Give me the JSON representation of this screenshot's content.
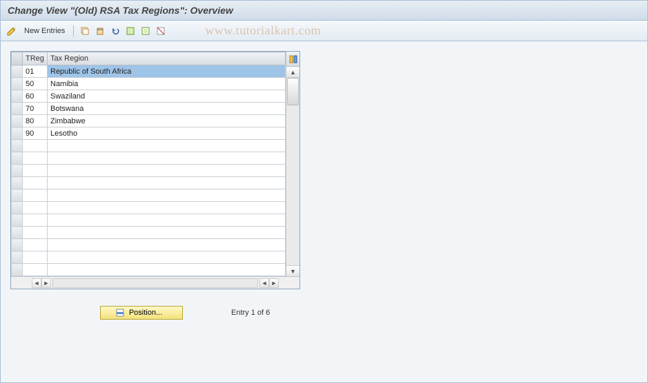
{
  "title": "Change View \"(Old) RSA Tax Regions\": Overview",
  "watermark": "www.tutorialkart.com",
  "toolbar": {
    "new_entries": "New Entries"
  },
  "grid": {
    "col_treg": "TReg",
    "col_region": "Tax Region",
    "rows": [
      {
        "treg": "01",
        "region": "Republic of South Africa",
        "selected": true
      },
      {
        "treg": "50",
        "region": "Namibia"
      },
      {
        "treg": "60",
        "region": "Swaziland"
      },
      {
        "treg": "70",
        "region": "Botswana"
      },
      {
        "treg": "80",
        "region": "Zimbabwe"
      },
      {
        "treg": "90",
        "region": "Lesotho"
      }
    ],
    "empty_rows": 11
  },
  "footer": {
    "position_btn": "Position...",
    "entry_text": "Entry 1 of 6"
  }
}
